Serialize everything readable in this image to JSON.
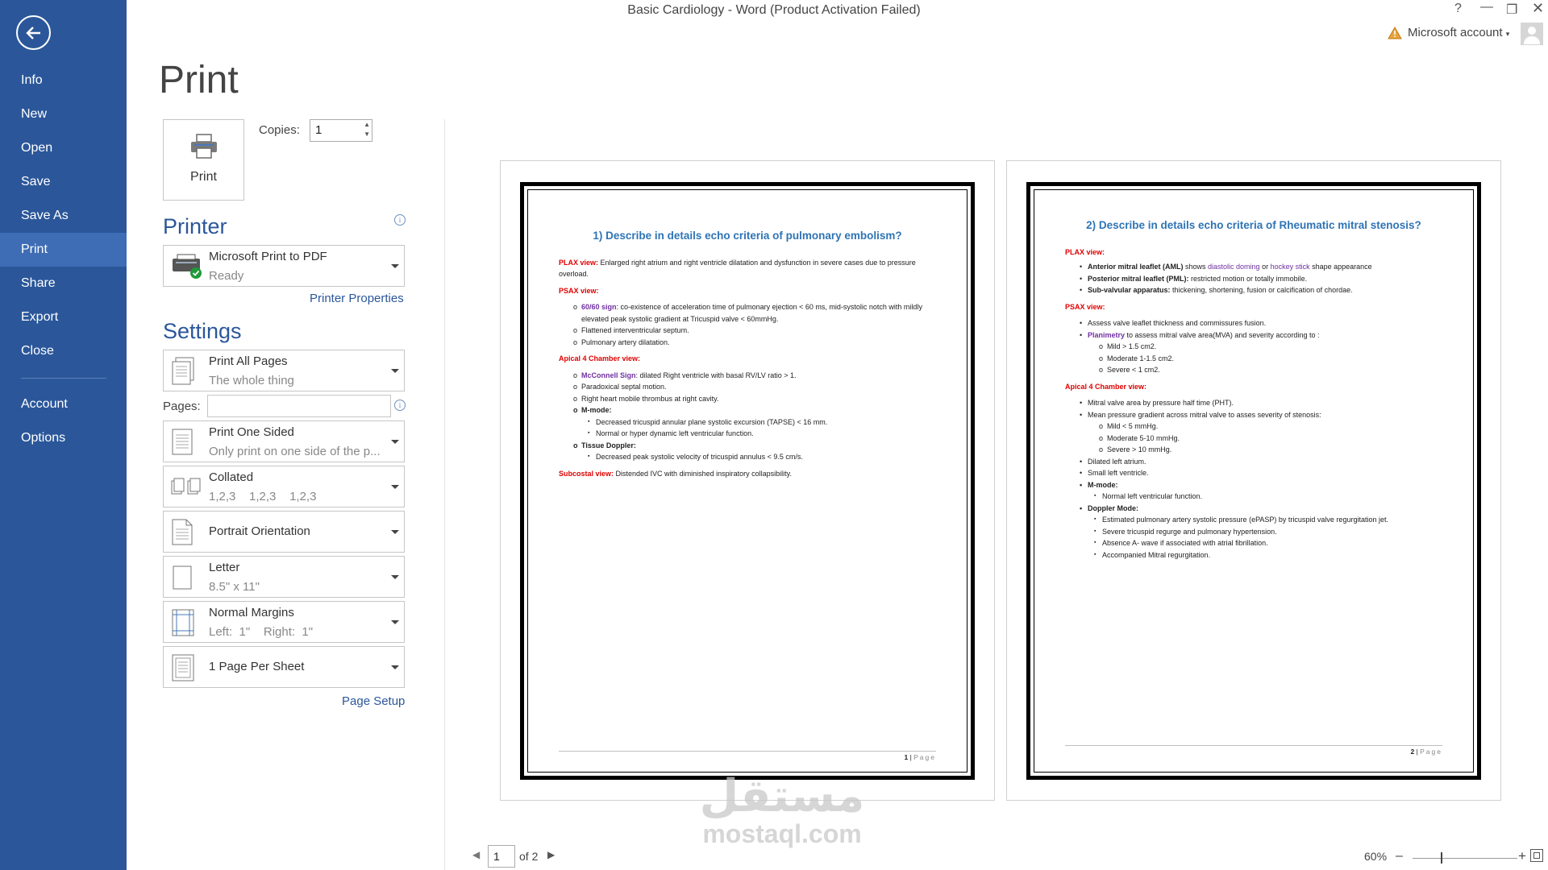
{
  "app": {
    "title": "Basic Cardiology - Word (Product Activation Failed)",
    "account_label": "Microsoft account"
  },
  "nav": {
    "items": [
      {
        "label": "Info"
      },
      {
        "label": "New"
      },
      {
        "label": "Open"
      },
      {
        "label": "Save"
      },
      {
        "label": "Save As"
      },
      {
        "label": "Print"
      },
      {
        "label": "Share"
      },
      {
        "label": "Export"
      },
      {
        "label": "Close"
      },
      {
        "label": "Account"
      },
      {
        "label": "Options"
      }
    ],
    "active": "Print"
  },
  "print": {
    "heading": "Print",
    "button_label": "Print",
    "copies_label": "Copies:",
    "copies_value": "1",
    "printer_heading": "Printer",
    "printer_name": "Microsoft Print to PDF",
    "printer_status": "Ready",
    "printer_properties": "Printer Properties",
    "settings_heading": "Settings",
    "settings": [
      {
        "title": "Print All Pages",
        "sub": "The whole thing"
      },
      {
        "title": "Print One Sided",
        "sub": "Only print on one side of the p..."
      },
      {
        "title": "Collated",
        "sub": "1,2,3    1,2,3    1,2,3"
      },
      {
        "title": "Portrait Orientation",
        "sub": ""
      },
      {
        "title": "Letter",
        "sub": "8.5\" x 11\""
      },
      {
        "title": "Normal Margins",
        "sub": "Left:  1\"    Right:  1\""
      },
      {
        "title": "1 Page Per Sheet",
        "sub": ""
      }
    ],
    "pages_label": "Pages:",
    "page_setup": "Page Setup"
  },
  "preview": {
    "page1": {
      "question": "1) Describe in details echo criteria of pulmonary embolism?",
      "plax_label": "PLAX view:",
      "plax_text": " Enlarged right atrium and right ventricle dilatation and dysfunction in severe cases due to pressure overload.",
      "psax_label": "PSAX view:",
      "psax_sign": "60/60 sign",
      "psax_sign_text": ": co-existence of acceleration time of pulmonary ejection < 60 ms, mid-systolic notch with mildly elevated peak systolic gradient at Tricuspid valve < 60mmHg.",
      "psax_2": "Flattened interventricular septum.",
      "psax_3": "Pulmonary artery dilatation.",
      "a4c_label": "Apical 4 Chamber view:",
      "mcconnell": "McConnell Sign",
      "mcconnell_text": ": dilated Right ventricle with basal RV/LV ratio > 1.",
      "a4c_2": "Paradoxical septal motion.",
      "a4c_3": "Right heart mobile thrombus at right cavity.",
      "mmode": "M-mode:",
      "mmode_1": "Decreased tricuspid annular plane systolic excursion (TAPSE) < 16 mm.",
      "mmode_2": "Normal or hyper dynamic left ventricular function.",
      "tissue": "Tissue Doppler:",
      "tissue_1": "Decreased peak systolic velocity of tricuspid annulus < 9.5 cm/s.",
      "subcostal_label": "Subcostal view:",
      "subcostal_text": " Distended IVC with diminished inspiratory collapsibility.",
      "footer_num": "1",
      "footer_word": "Page"
    },
    "page2": {
      "question": "2) Describe in details echo criteria of Rheumatic mitral stenosis?",
      "plax_label": "PLAX view:",
      "aml_b": "Anterior mitral leaflet (AML)",
      "aml_t1": " shows ",
      "aml_p1": "diastolic doming",
      "aml_t2": " or ",
      "aml_p2": "hockey stick",
      "aml_t3": " shape appearance",
      "pml_b": "Posterior mitral leaflet (PML):",
      "pml_t": " restricted motion or totally immobile.",
      "sub_b": "Sub-valvular apparatus:",
      "sub_t": " thickening, shortening, fusion or calcification of chordae.",
      "psax_label": "PSAX view:",
      "psax_1": "Assess valve leaflet thickness and commissures fusion.",
      "plan_p": "Planimetry",
      "plan_t": " to assess mitral valve area(MVA) and severity according to :",
      "mva_1": "Mild > 1.5 cm2.",
      "mva_2": "Moderate 1-1.5 cm2.",
      "mva_3": "Severe < 1 cm2.",
      "a4c_label": "Apical 4 Chamber view:",
      "a4c_1": "Mitral valve area by pressure half time (PHT).",
      "a4c_2": "Mean pressure gradient across mitral valve to asses severity of stenosis:",
      "grad_1": "Mild < 5 mmHg.",
      "grad_2": "Moderate 5-10 mmHg.",
      "grad_3": "Severe > 10 mmHg.",
      "a4c_3": "Dilated left atrium.",
      "a4c_4": "Small left ventricle.",
      "mmode": "M-mode:",
      "mmode_1": "Normal left ventricular function.",
      "doppler": "Doppler Mode:",
      "dop_1": "Estimated pulmonary artery systolic pressure (ePASP) by tricuspid valve regurgitation jet.",
      "dop_2": "Severe tricuspid regurge and pulmonary hypertension.",
      "dop_3": "Absence A- wave if associated with atrial fibrillation.",
      "dop_4": "Accompanied Mitral regurgitation.",
      "footer_num": "2",
      "footer_word": "Page"
    }
  },
  "status": {
    "page_value": "1",
    "of_label": "of 2",
    "zoom": "60%"
  },
  "watermark": {
    "arabic": "مستقل",
    "latin": "mostaql.com"
  },
  "colors": {
    "nav_bg": "#2b579a",
    "accent": "#2b579a",
    "heading_blue": "#2e74b5",
    "red": "#e00000",
    "purple": "#7030a0"
  }
}
